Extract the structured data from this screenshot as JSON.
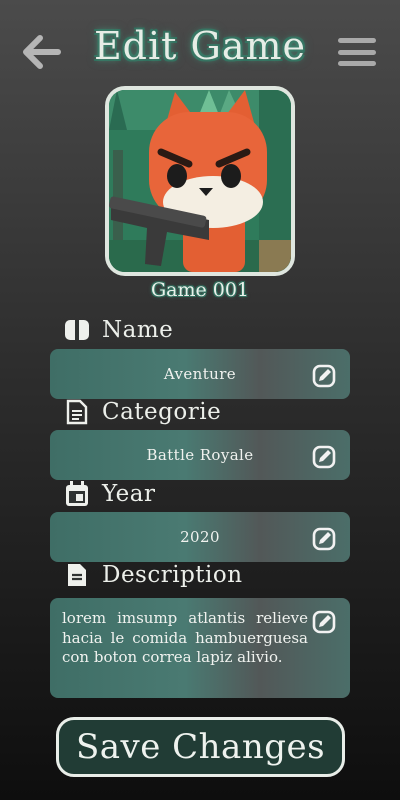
{
  "header": {
    "title": "Edit Game",
    "back_icon": "arrow-left-icon",
    "menu_icon": "hamburger-menu-icon"
  },
  "game": {
    "name": "Game 001",
    "image_icon": "fox-with-gun-game-art"
  },
  "fields": {
    "name": {
      "label": "Name",
      "value": "Aventure",
      "icon": "id-card-icon"
    },
    "category": {
      "label": "Categorie",
      "value": "Battle Royale",
      "icon": "document-icon"
    },
    "year": {
      "label": "Year",
      "value": "2020",
      "icon": "calendar-icon"
    },
    "description": {
      "label": "Description",
      "value": "lorem imsump atlantis relieve hacia le comida hambuerguesa con boton correa lapiz alivio.",
      "icon": "description-icon"
    }
  },
  "actions": {
    "save_label": "Save Changes",
    "edit_icon": "edit-pencil-icon"
  },
  "colors": {
    "accent": "#3f7e6b",
    "field_bg": "#4a7a72",
    "button_bg": "#213c35"
  }
}
